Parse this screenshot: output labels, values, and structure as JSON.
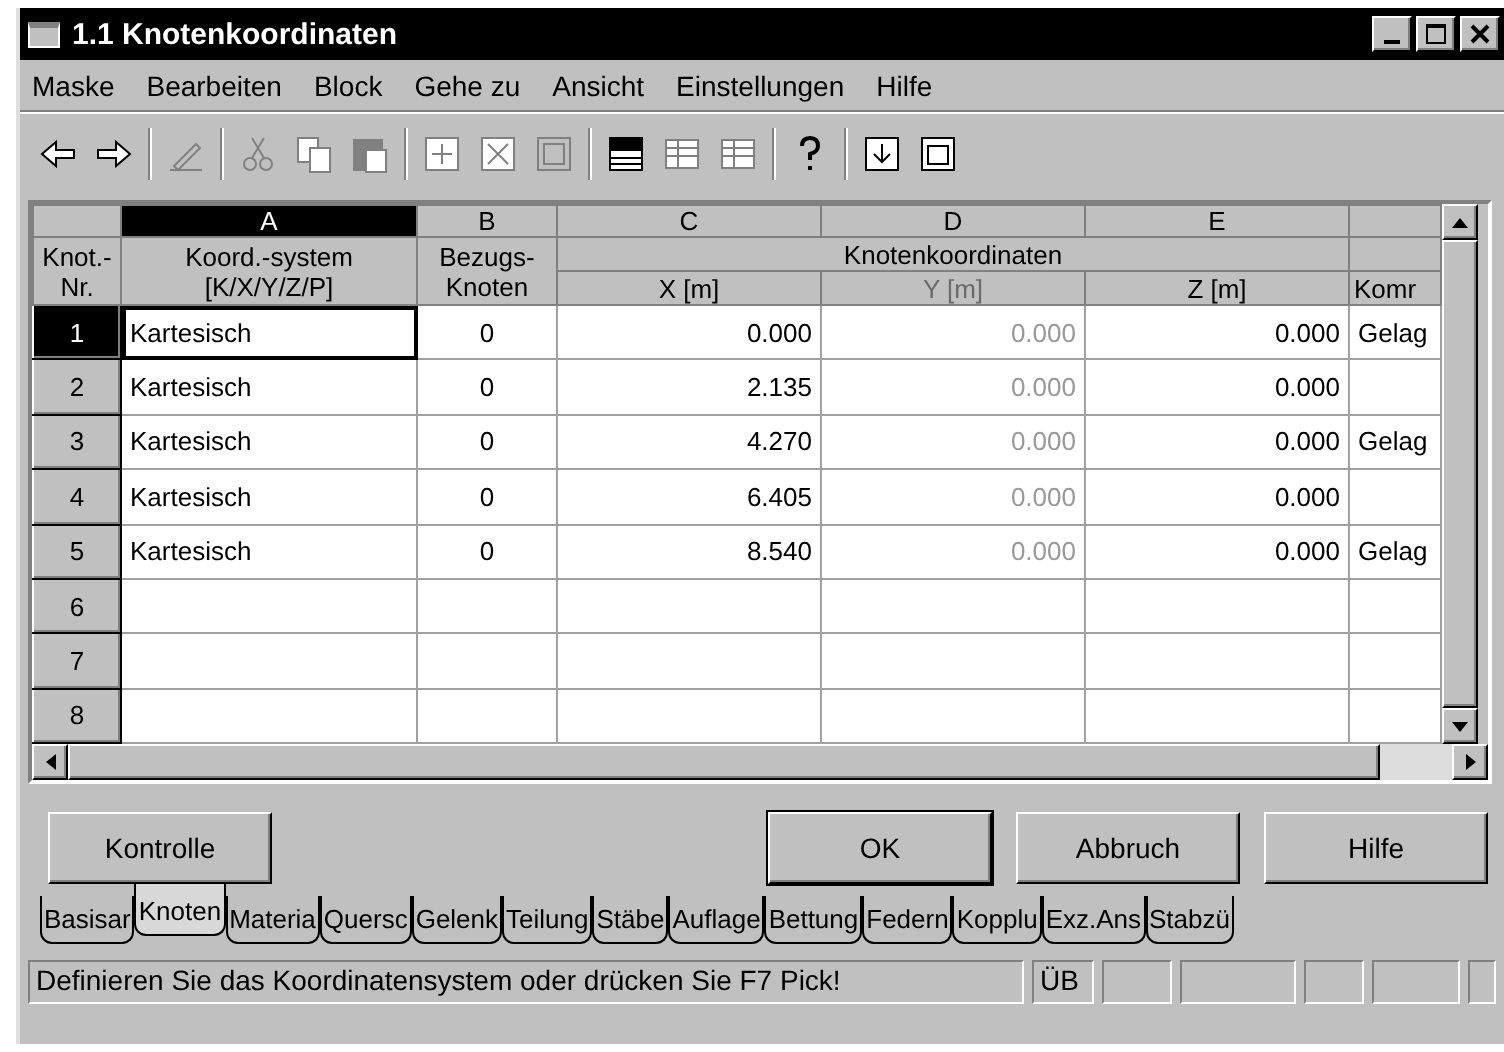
{
  "window": {
    "title": "1.1 Knotenkoordinaten"
  },
  "menu": [
    {
      "label": "Maske"
    },
    {
      "label": "Bearbeiten"
    },
    {
      "label": "Block"
    },
    {
      "label": "Gehe zu"
    },
    {
      "label": "Ansicht"
    },
    {
      "label": "Einstellungen"
    },
    {
      "label": "Hilfe"
    }
  ],
  "toolbar": [
    {
      "kind": "back",
      "disabled": false
    },
    {
      "kind": "forward",
      "disabled": false
    },
    {
      "kind": "sep"
    },
    {
      "kind": "pencil",
      "disabled": true
    },
    {
      "kind": "sep"
    },
    {
      "kind": "cut",
      "disabled": true
    },
    {
      "kind": "copy",
      "disabled": true
    },
    {
      "kind": "paste",
      "disabled": true
    },
    {
      "kind": "sep"
    },
    {
      "kind": "plusbox",
      "disabled": true
    },
    {
      "kind": "xbox",
      "disabled": true
    },
    {
      "kind": "frame",
      "disabled": true
    },
    {
      "kind": "sep"
    },
    {
      "kind": "tablehead",
      "disabled": false
    },
    {
      "kind": "rows",
      "disabled": true
    },
    {
      "kind": "rows",
      "disabled": true
    },
    {
      "kind": "sep"
    },
    {
      "kind": "help",
      "disabled": false
    },
    {
      "kind": "sep"
    },
    {
      "kind": "import",
      "disabled": false
    },
    {
      "kind": "list",
      "disabled": false
    }
  ],
  "table": {
    "row_header": [
      "Knot.-",
      "Nr."
    ],
    "columns": [
      {
        "letter": "A",
        "header": [
          "Koord.-system",
          "[K/X/Y/Z/P]"
        ],
        "selected": true,
        "disabled": false
      },
      {
        "letter": "B",
        "header": [
          "Bezugs-",
          "Knoten"
        ],
        "selected": false,
        "disabled": false
      },
      {
        "letter": "C",
        "header": [
          "X [m]"
        ],
        "selected": false,
        "disabled": false
      },
      {
        "letter": "D",
        "header": [
          "Y [m]"
        ],
        "selected": false,
        "disabled": true
      },
      {
        "letter": "E",
        "header": [
          "Z [m]"
        ],
        "selected": false,
        "disabled": false
      },
      {
        "header": [
          "Komr"
        ],
        "selected": false,
        "disabled": false
      }
    ],
    "group_header": "Knotenkoordinaten",
    "rows": [
      {
        "nr": "1",
        "selected": true,
        "cells": [
          "Kartesisch",
          "0",
          "0.000",
          "0.000",
          "0.000",
          "Gelag"
        ]
      },
      {
        "nr": "2",
        "selected": false,
        "cells": [
          "Kartesisch",
          "0",
          "2.135",
          "0.000",
          "0.000",
          ""
        ]
      },
      {
        "nr": "3",
        "selected": false,
        "cells": [
          "Kartesisch",
          "0",
          "4.270",
          "0.000",
          "0.000",
          "Gelag"
        ]
      },
      {
        "nr": "4",
        "selected": false,
        "cells": [
          "Kartesisch",
          "0",
          "6.405",
          "0.000",
          "0.000",
          ""
        ]
      },
      {
        "nr": "5",
        "selected": false,
        "cells": [
          "Kartesisch",
          "0",
          "8.540",
          "0.000",
          "0.000",
          "Gelag"
        ]
      },
      {
        "nr": "6",
        "selected": false,
        "cells": [
          "",
          "",
          "",
          "",
          "",
          ""
        ]
      },
      {
        "nr": "7",
        "selected": false,
        "cells": [
          "",
          "",
          "",
          "",
          "",
          ""
        ]
      },
      {
        "nr": "8",
        "selected": false,
        "cells": [
          "",
          "",
          "",
          "",
          "",
          ""
        ]
      }
    ]
  },
  "buttons": [
    {
      "label": "Kontrolle",
      "default": false
    },
    {
      "label": "OK",
      "default": true
    },
    {
      "label": "Abbruch",
      "default": false
    },
    {
      "label": "Hilfe",
      "default": false
    }
  ],
  "tabs": [
    {
      "label": "Basisar",
      "selected": false
    },
    {
      "label": "Knoten",
      "selected": true
    },
    {
      "label": "Materia",
      "selected": false
    },
    {
      "label": "Quersc",
      "selected": false
    },
    {
      "label": "Gelenk",
      "selected": false
    },
    {
      "label": "Teilung",
      "selected": false
    },
    {
      "label": "Stäbe",
      "selected": false
    },
    {
      "label": "Auflage",
      "selected": false
    },
    {
      "label": "Bettung",
      "selected": false
    },
    {
      "label": "Federn",
      "selected": false
    },
    {
      "label": "Kopplu",
      "selected": false
    },
    {
      "label": "Exz.Ans",
      "selected": false
    },
    {
      "label": "Stabzü",
      "selected": false
    }
  ],
  "status_bar": {
    "message": "Definieren Sie das Koordinatensystem oder drücken Sie F7 Pick!",
    "panels": [
      "ÜB"
    ]
  }
}
